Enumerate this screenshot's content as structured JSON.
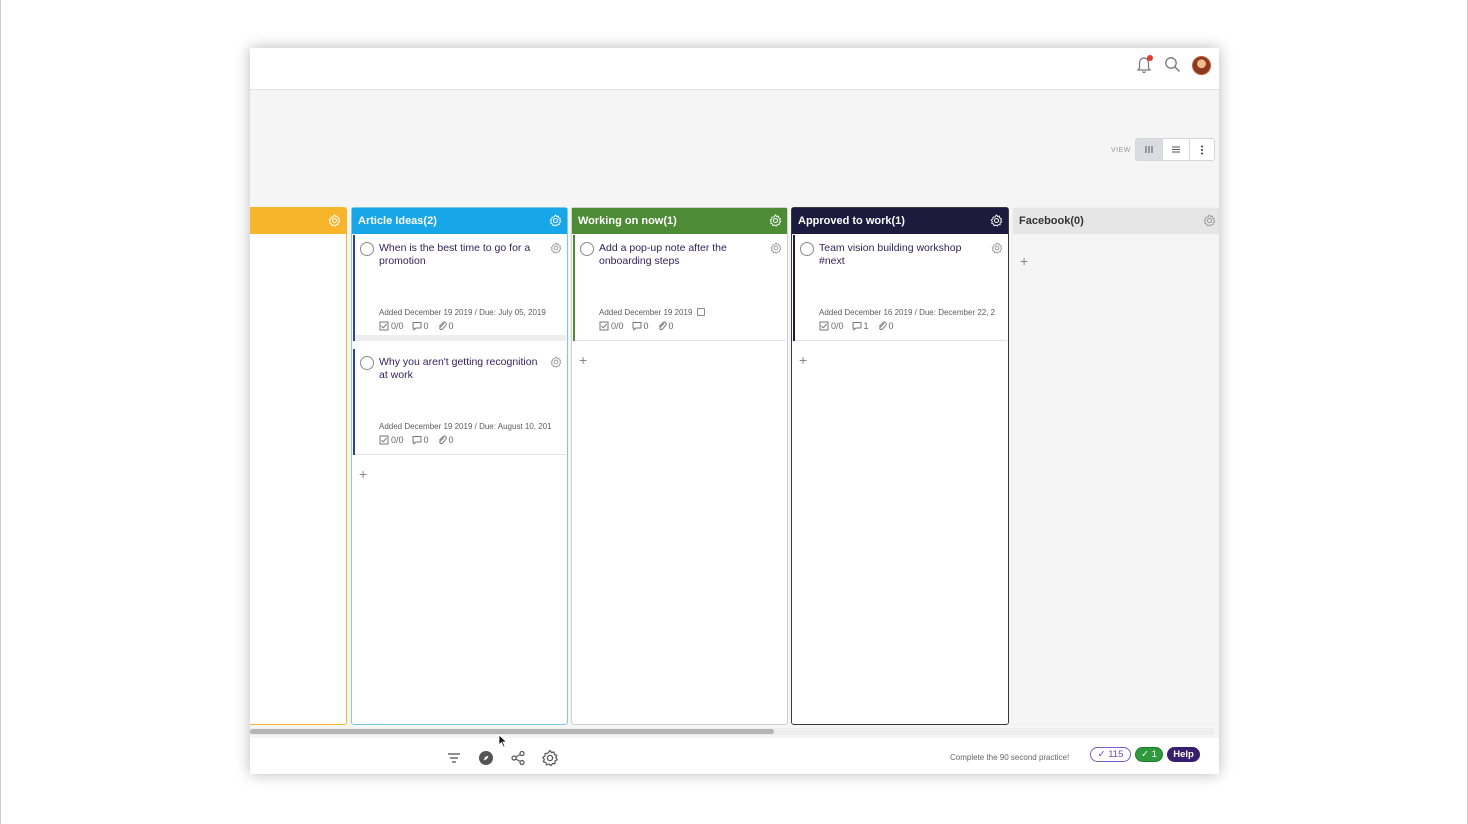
{
  "header": {
    "notification_icon": "bell-icon",
    "search_icon": "search-icon"
  },
  "view_switcher": {
    "label": "VIEW",
    "options": [
      "board-view",
      "list-view",
      "more-options"
    ]
  },
  "columns": [
    {
      "key": "yellow",
      "title": "",
      "color": "#f7b52c",
      "border": "#f7b52c",
      "cards": [],
      "add_label": ""
    },
    {
      "key": "article",
      "title": "Article Ideas(2)",
      "color": "#17a6e8",
      "border": "#7cc9ea",
      "cards": [
        {
          "title": "When is the best time to go for a promotion",
          "added": "Added December 19 2019",
          "due": "Due: July 05, 2019",
          "checklist": "0/0",
          "comments": "0",
          "attachments": "0"
        },
        {
          "title": "Why you aren't getting recognition at work",
          "added": "Added December 19 2019",
          "due": "Due: August 10, 201",
          "checklist": "0/0",
          "comments": "0",
          "attachments": "0"
        }
      ],
      "add_label": "+"
    },
    {
      "key": "working",
      "title": "Working on now(1)",
      "color": "#4e8b35",
      "border": "#cfcfcf",
      "cards": [
        {
          "title": "Add a pop-up note after the onboarding steps",
          "added": "Added December 19 2019",
          "due": "",
          "checklist": "0/0",
          "comments": "0",
          "attachments": "0"
        }
      ],
      "add_label": "+"
    },
    {
      "key": "approved",
      "title": "Approved to work(1)",
      "color": "#1e1a3d",
      "border": "#3a3a3a",
      "cards": [
        {
          "title": "Team vision building workshop #next",
          "added": "Added December 16 2019",
          "due": "Due: December 22, 2",
          "checklist": "0/0",
          "comments": "1",
          "attachments": "0"
        }
      ],
      "add_label": "+"
    },
    {
      "key": "facebook",
      "title": "Facebook(0)",
      "color": "#e6e6e6",
      "border": "#e6e6e6",
      "cards": [],
      "add_label": "+"
    }
  ],
  "footer": {
    "practice_text": "Complete the 90 second practice!",
    "points": "115",
    "checks": "1",
    "help_label": "Help",
    "icons": [
      "filter-icon",
      "compass-icon",
      "share-icon",
      "settings-icon"
    ]
  }
}
